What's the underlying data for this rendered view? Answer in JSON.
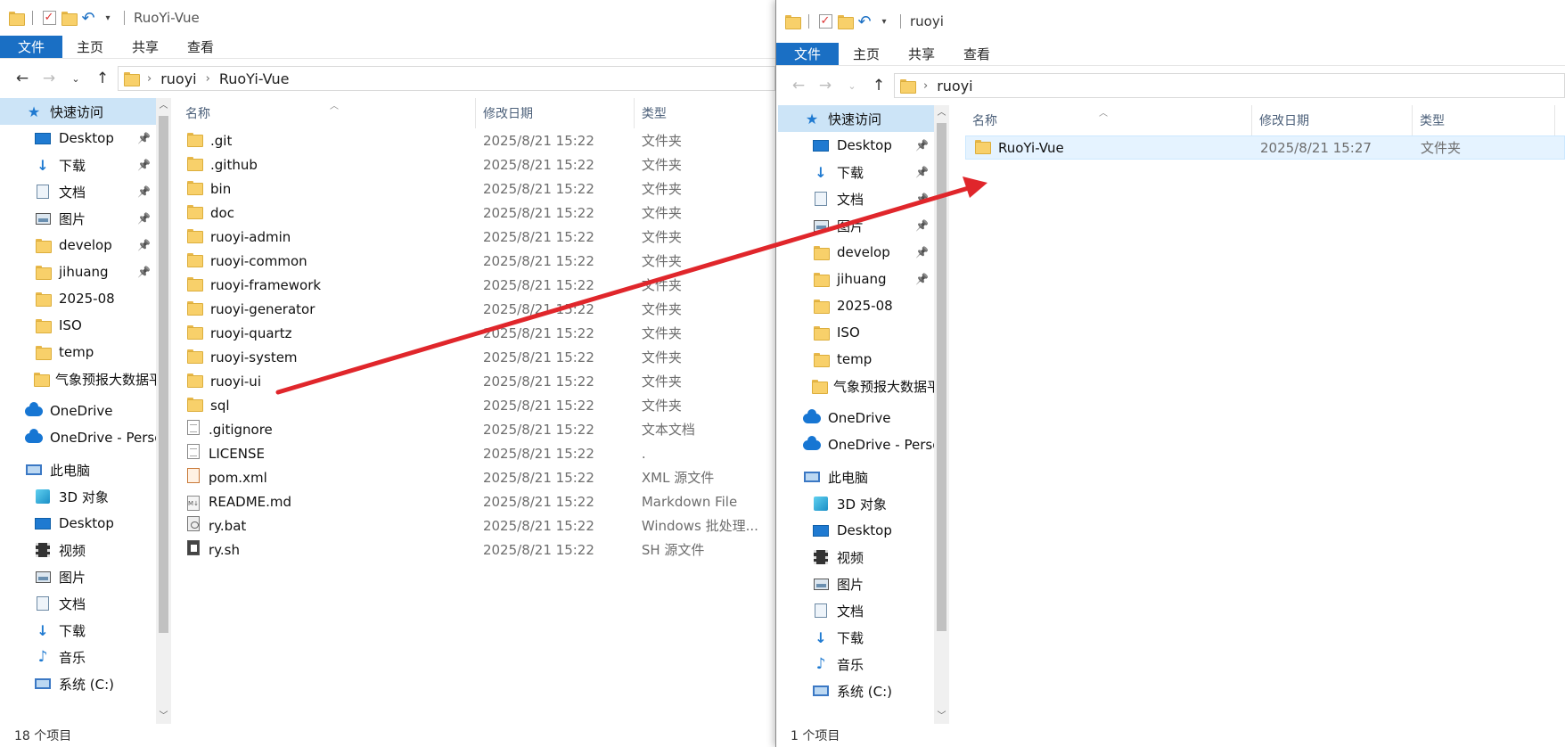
{
  "left": {
    "title": "RuoYi-Vue",
    "tabs": {
      "file": "文件",
      "home": "主页",
      "share": "共享",
      "view": "查看"
    },
    "breadcrumb": [
      "ruoyi",
      "RuoYi-Vue"
    ],
    "columns": {
      "name": "名称",
      "date": "修改日期",
      "type": "类型"
    },
    "nav": [
      {
        "label": "快速访问",
        "icon": "star-icon"
      },
      {
        "label": "Desktop",
        "icon": "desktop-icon",
        "pinned": true
      },
      {
        "label": "下载",
        "icon": "download-icon",
        "pinned": true
      },
      {
        "label": "文档",
        "icon": "document-icon",
        "pinned": true
      },
      {
        "label": "图片",
        "icon": "picture-icon",
        "pinned": true
      },
      {
        "label": "develop",
        "icon": "folder-icon",
        "pinned": true
      },
      {
        "label": "jihuang",
        "icon": "folder-icon",
        "pinned": true
      },
      {
        "label": "2025-08",
        "icon": "folder-icon"
      },
      {
        "label": "ISO",
        "icon": "folder-icon"
      },
      {
        "label": "temp",
        "icon": "folder-icon"
      },
      {
        "label": "气象预报大数据平",
        "icon": "folder-icon"
      },
      {
        "label": "OneDrive",
        "icon": "onedrive-icon"
      },
      {
        "label": "OneDrive - Perso",
        "icon": "onedrive-icon"
      },
      {
        "label": "此电脑",
        "icon": "this-pc-icon"
      },
      {
        "label": "3D 对象",
        "icon": "3d-objects-icon"
      },
      {
        "label": "Desktop",
        "icon": "desktop-icon"
      },
      {
        "label": "视频",
        "icon": "video-icon"
      },
      {
        "label": "图片",
        "icon": "picture-icon"
      },
      {
        "label": "文档",
        "icon": "document-icon"
      },
      {
        "label": "下载",
        "icon": "download-icon"
      },
      {
        "label": "音乐",
        "icon": "music-icon"
      },
      {
        "label": "系统 (C:)",
        "icon": "drive-icon"
      }
    ],
    "files": [
      {
        "name": ".git",
        "date": "2025/8/21 15:22",
        "type": "文件夹",
        "icon": "folder"
      },
      {
        "name": ".github",
        "date": "2025/8/21 15:22",
        "type": "文件夹",
        "icon": "folder"
      },
      {
        "name": "bin",
        "date": "2025/8/21 15:22",
        "type": "文件夹",
        "icon": "folder"
      },
      {
        "name": "doc",
        "date": "2025/8/21 15:22",
        "type": "文件夹",
        "icon": "folder"
      },
      {
        "name": "ruoyi-admin",
        "date": "2025/8/21 15:22",
        "type": "文件夹",
        "icon": "folder"
      },
      {
        "name": "ruoyi-common",
        "date": "2025/8/21 15:22",
        "type": "文件夹",
        "icon": "folder"
      },
      {
        "name": "ruoyi-framework",
        "date": "2025/8/21 15:22",
        "type": "文件夹",
        "icon": "folder"
      },
      {
        "name": "ruoyi-generator",
        "date": "2025/8/21 15:22",
        "type": "文件夹",
        "icon": "folder"
      },
      {
        "name": "ruoyi-quartz",
        "date": "2025/8/21 15:22",
        "type": "文件夹",
        "icon": "folder"
      },
      {
        "name": "ruoyi-system",
        "date": "2025/8/21 15:22",
        "type": "文件夹",
        "icon": "folder"
      },
      {
        "name": "ruoyi-ui",
        "date": "2025/8/21 15:22",
        "type": "文件夹",
        "icon": "folder"
      },
      {
        "name": "sql",
        "date": "2025/8/21 15:22",
        "type": "文件夹",
        "icon": "folder"
      },
      {
        "name": ".gitignore",
        "date": "2025/8/21 15:22",
        "type": "文本文档",
        "icon": "doc"
      },
      {
        "name": "LICENSE",
        "date": "2025/8/21 15:22",
        "type": ".",
        "icon": "doc"
      },
      {
        "name": "pom.xml",
        "date": "2025/8/21 15:22",
        "type": "XML 源文件",
        "icon": "rss"
      },
      {
        "name": "README.md",
        "date": "2025/8/21 15:22",
        "type": "Markdown File",
        "icon": "md"
      },
      {
        "name": "ry.bat",
        "date": "2025/8/21 15:22",
        "type": "Windows 批处理...",
        "icon": "bat"
      },
      {
        "name": "ry.sh",
        "date": "2025/8/21 15:22",
        "type": "SH 源文件",
        "icon": "sh"
      }
    ],
    "status": "18 个项目"
  },
  "right": {
    "title": "ruoyi",
    "tabs": {
      "file": "文件",
      "home": "主页",
      "share": "共享",
      "view": "查看"
    },
    "breadcrumb": [
      "ruoyi"
    ],
    "columns": {
      "name": "名称",
      "date": "修改日期",
      "type": "类型"
    },
    "nav": [
      {
        "label": "快速访问",
        "icon": "star-icon"
      },
      {
        "label": "Desktop",
        "icon": "desktop-icon",
        "pinned": true
      },
      {
        "label": "下载",
        "icon": "download-icon",
        "pinned": true
      },
      {
        "label": "文档",
        "icon": "document-icon",
        "pinned": true
      },
      {
        "label": "图片",
        "icon": "picture-icon",
        "pinned": true
      },
      {
        "label": "develop",
        "icon": "folder-icon",
        "pinned": true
      },
      {
        "label": "jihuang",
        "icon": "folder-icon",
        "pinned": true
      },
      {
        "label": "2025-08",
        "icon": "folder-icon"
      },
      {
        "label": "ISO",
        "icon": "folder-icon"
      },
      {
        "label": "temp",
        "icon": "folder-icon"
      },
      {
        "label": "气象预报大数据平",
        "icon": "folder-icon"
      },
      {
        "label": "OneDrive",
        "icon": "onedrive-icon"
      },
      {
        "label": "OneDrive - Perso",
        "icon": "onedrive-icon"
      },
      {
        "label": "此电脑",
        "icon": "this-pc-icon"
      },
      {
        "label": "3D 对象",
        "icon": "3d-objects-icon"
      },
      {
        "label": "Desktop",
        "icon": "desktop-icon"
      },
      {
        "label": "视频",
        "icon": "video-icon"
      },
      {
        "label": "图片",
        "icon": "picture-icon"
      },
      {
        "label": "文档",
        "icon": "document-icon"
      },
      {
        "label": "下载",
        "icon": "download-icon"
      },
      {
        "label": "音乐",
        "icon": "music-icon"
      },
      {
        "label": "系统 (C:)",
        "icon": "drive-icon"
      }
    ],
    "files": [
      {
        "name": "RuoYi-Vue",
        "date": "2025/8/21 15:27",
        "type": "文件夹",
        "icon": "folder"
      }
    ],
    "status": "1 个项目"
  },
  "colors": {
    "accent": "#1a6fc4",
    "selection": "#cce4f7",
    "arrow": "#e0262b"
  }
}
